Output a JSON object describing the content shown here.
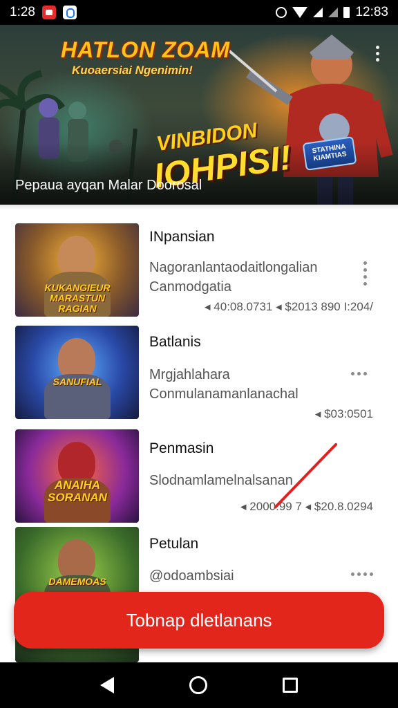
{
  "status_bar": {
    "left_time": "1:28",
    "clock": "12:83",
    "icons": [
      "app-notification-red-icon",
      "app-notification-blue-icon",
      "alarm-icon",
      "wifi-icon",
      "signal-icon",
      "battery-icon"
    ]
  },
  "banner": {
    "title": "HATLON ZOAM",
    "subtitle": "Kuoaersiai Ngenimin!",
    "promo_line1": "VINBIDON",
    "promo_line2": "IOHPISI!",
    "mini_logo": "STATHINA KIAMTIAS",
    "caption": "Pepaua ayqan Malar Doorosal",
    "colors": {
      "title": "#ffc21a",
      "caption": "#ffffff"
    }
  },
  "games": [
    {
      "title": "INpansian",
      "desc_line1": "Nagoranlantaodaitlongalian",
      "desc_line2": "Canmodgatia",
      "stat1": "40:08.0731",
      "stat2": "$2013 890 I:204/",
      "thumb_logo": "KUKANGIEUR MARASTUN RAGIAN"
    },
    {
      "title": "Batlanis",
      "desc_line1": "Mrgjahlahara",
      "desc_line2": "Conmulanamanlanachal",
      "stat1": "",
      "stat2": "$03:0501",
      "thumb_logo": "SANUFIAL"
    },
    {
      "title": "Penmasin",
      "desc_line1": "Slodnamlamelnalsanan",
      "desc_line2": "",
      "stat1": "2000:99 7",
      "stat2": "$20.8.0294",
      "thumb_logo": "ANAIHA SORANAN"
    },
    {
      "title": "Petulan",
      "desc_line1": "@odoambsiai",
      "desc_line2": "",
      "stat1": "",
      "stat2": "",
      "thumb_logo": "DAMEMOAS"
    }
  ],
  "cta": {
    "label": "Tobnap dletlanans",
    "color": "#e3261c"
  },
  "nav": {
    "back": "back-icon",
    "home": "home-icon",
    "recents": "recents-icon"
  }
}
